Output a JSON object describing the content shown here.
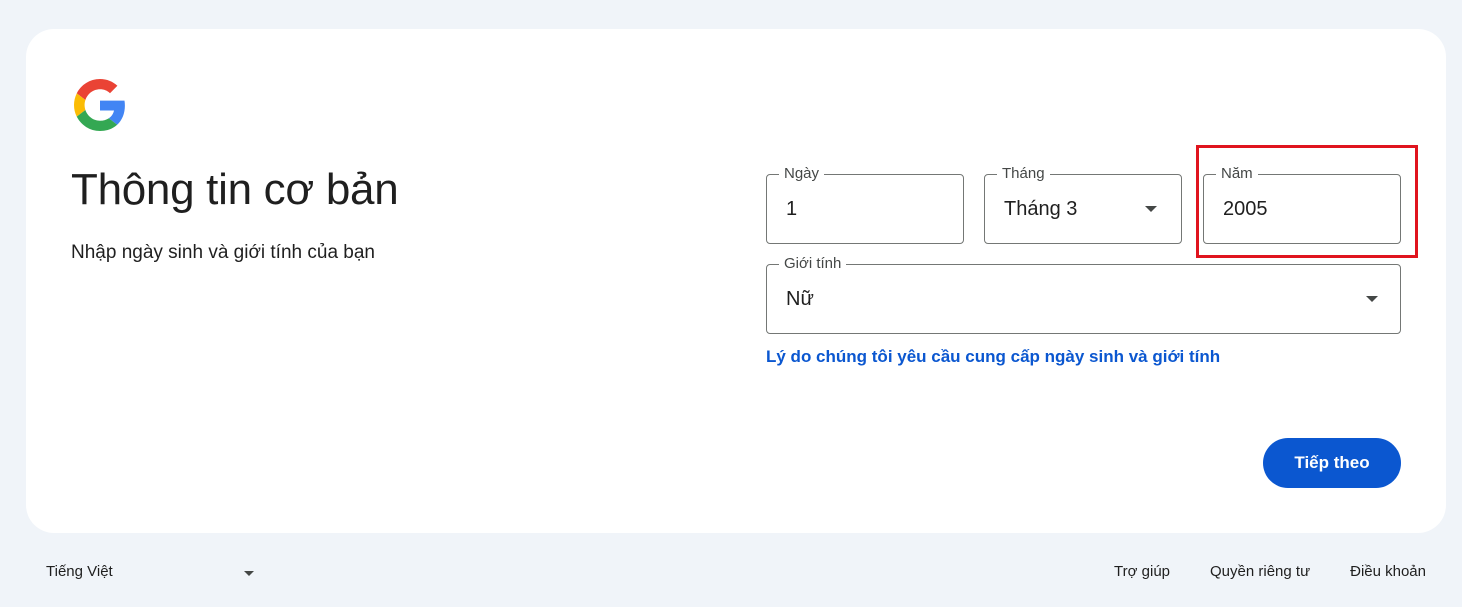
{
  "header": {
    "logo_icon": "google-g-logo-icon",
    "title": "Thông tin cơ bản",
    "subtitle": "Nhập ngày sinh và giới tính của bạn"
  },
  "form": {
    "day": {
      "label": "Ngày",
      "value": "1"
    },
    "month": {
      "label": "Tháng",
      "value": "Tháng 3",
      "icon": "caret-down-icon"
    },
    "year": {
      "label": "Năm",
      "value": "2005"
    },
    "gender": {
      "label": "Giới tính",
      "value": "Nữ",
      "icon": "caret-down-icon"
    },
    "why_link": "Lý do chúng tôi yêu cầu cung cấp ngày sinh và giới tính",
    "next_button": "Tiếp theo"
  },
  "annotation": {
    "highlight_color": "#e0141e"
  },
  "footer": {
    "language": "Tiếng Việt",
    "links": [
      "Trợ giúp",
      "Quyền riêng tư",
      "Điều khoản"
    ]
  },
  "colors": {
    "page_background": "#f0f4f9",
    "card_background": "#ffffff",
    "accent": "#0b57d0",
    "text": "#1f1f1f",
    "outline": "#747775"
  }
}
